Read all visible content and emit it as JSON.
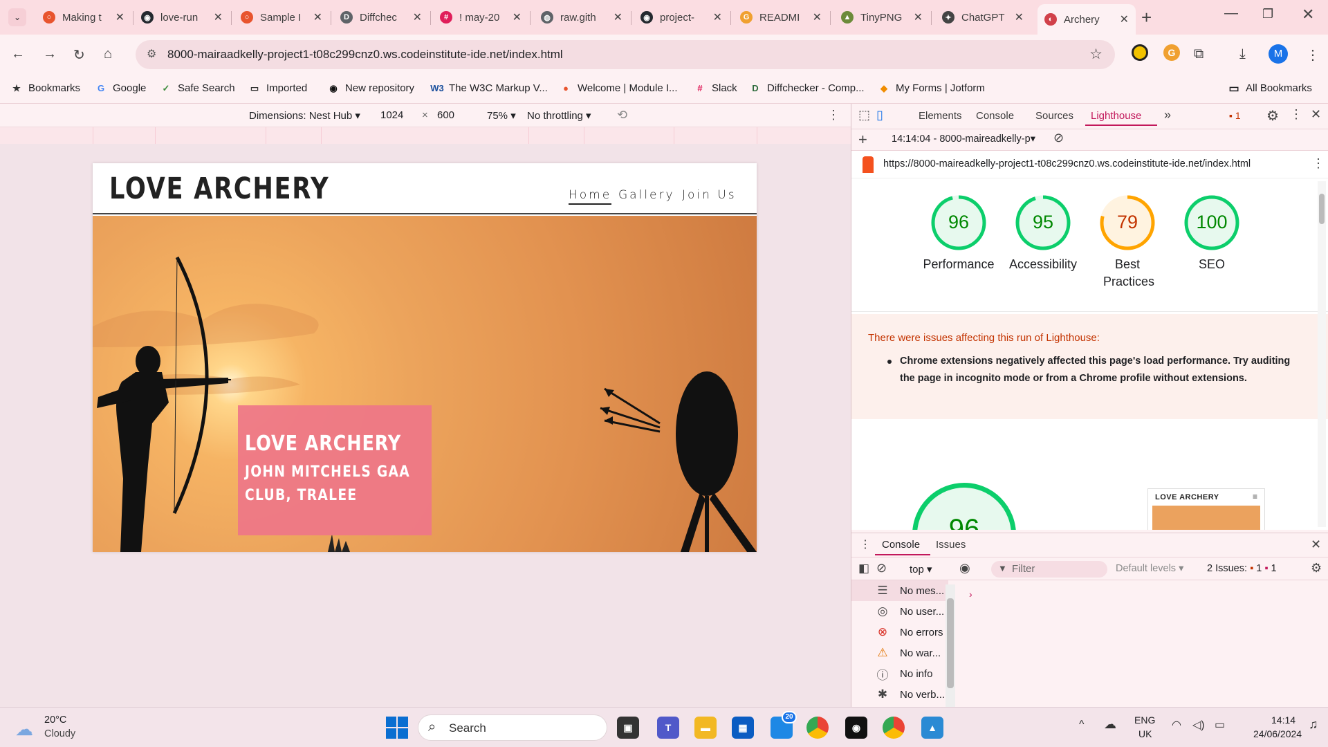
{
  "tabs": [
    {
      "title": "Making t",
      "color": "#e8542e",
      "glyph": "○"
    },
    {
      "title": "love-run",
      "color": "#24292f",
      "glyph": "◉"
    },
    {
      "title": "Sample I",
      "color": "#e8542e",
      "glyph": "○"
    },
    {
      "title": "Diffchec",
      "color": "#5f6368",
      "glyph": "D"
    },
    {
      "title": "! may-20",
      "color": "#e01e5a",
      "glyph": "#"
    },
    {
      "title": "raw.gith",
      "color": "#5f6368",
      "glyph": "◍"
    },
    {
      "title": "project-",
      "color": "#24292f",
      "glyph": "◉"
    },
    {
      "title": "READMI",
      "color": "#f0a030",
      "glyph": "G"
    },
    {
      "title": "TinyPNG",
      "color": "#6c8b3a",
      "glyph": "▲"
    },
    {
      "title": "ChatGPT",
      "color": "#444444",
      "glyph": "✦"
    },
    {
      "title": "Archery",
      "color": "#d1414a",
      "glyph": "◐"
    }
  ],
  "address_bar": {
    "url": "8000-mairaadkelly-project1-t08c299cnz0.ws.codeinstitute-ide.net/index.html"
  },
  "profile_initial": "M",
  "bookmarks": [
    {
      "label": "Bookmarks",
      "icon": "star-icon"
    },
    {
      "label": "Google",
      "icon": "google-icon"
    },
    {
      "label": "Safe Search",
      "icon": "check-icon"
    },
    {
      "label": "Imported",
      "icon": "folder-icon"
    },
    {
      "label": "New repository",
      "icon": "github-icon"
    },
    {
      "label": "The W3C Markup V...",
      "icon": "w3c-icon"
    },
    {
      "label": "Welcome | Module I...",
      "icon": "circle-icon"
    },
    {
      "label": "Slack",
      "icon": "slack-icon"
    },
    {
      "label": "Diffchecker - Comp...",
      "icon": "diffchecker-icon"
    },
    {
      "label": "My Forms | Jotform",
      "icon": "jotform-icon"
    }
  ],
  "all_bookmarks": "All Bookmarks",
  "device_toolbar": {
    "dimensions_label": "Dimensions: Nest Hub",
    "width": "1024",
    "times": "×",
    "height": "600",
    "zoom": "75%",
    "throttling": "No throttling"
  },
  "site": {
    "logo": "LOVE ARCHERY",
    "nav": [
      "Home",
      "Gallery",
      "Join Us"
    ],
    "hero_title": "LOVE ARCHERY",
    "hero_subtitle": "JOHN MITCHELS GAA CLUB, TRALEE"
  },
  "devtools": {
    "tabs": [
      "Elements",
      "Console",
      "Sources",
      "Lighthouse"
    ],
    "active_tab": "Lighthouse",
    "issue_count": "1",
    "report_time": "14:14:04 - 8000-maireadkelly-p",
    "report_url": "https://8000-maireadkelly-project1-t08c299cnz0.ws.codeinstitute-ide.net/index.html"
  },
  "lighthouse": {
    "scores": [
      {
        "label": "Performance",
        "value": 96,
        "color": "#0cce6b",
        "text_color": "#008800",
        "bg": "#e7f9ee"
      },
      {
        "label": "Accessibility",
        "value": 95,
        "color": "#0cce6b",
        "text_color": "#008800",
        "bg": "#e7f9ee"
      },
      {
        "label": "Best Practices",
        "value": 79,
        "color": "#ffa400",
        "text_color": "#c33300",
        "bg": "#fff3e0"
      },
      {
        "label": "SEO",
        "value": 100,
        "color": "#0cce6b",
        "text_color": "#008800",
        "bg": "#e7f9ee"
      }
    ],
    "warning_title": "There were issues affecting this run of Lighthouse:",
    "warning_body": "Chrome extensions negatively affected this page's load performance. Try auditing the page in incognito mode or from a Chrome profile without extensions.",
    "big_score": "96",
    "thumbnail_title": "LOVE ARCHERY"
  },
  "console_drawer": {
    "tabs": [
      "Console",
      "Issues"
    ],
    "context": "top",
    "filter_placeholder": "Filter",
    "levels": "Default levels",
    "issues_label": "2 Issues:",
    "issue_a": "1",
    "issue_b": "1",
    "sidebar": [
      {
        "label": "No mes...",
        "icon": "list-icon"
      },
      {
        "label": "No user...",
        "icon": "user-icon"
      },
      {
        "label": "No errors",
        "icon": "error-icon"
      },
      {
        "label": "No war...",
        "icon": "warning-icon"
      },
      {
        "label": "No info",
        "icon": "info-icon"
      },
      {
        "label": "No verb...",
        "icon": "bug-icon"
      }
    ]
  },
  "taskbar": {
    "weather_temp": "20°C",
    "weather_desc": "Cloudy",
    "search_placeholder": "Search",
    "store_badge": "20",
    "lang": "ENG",
    "region": "UK",
    "time": "14:14",
    "date": "24/06/2024"
  }
}
